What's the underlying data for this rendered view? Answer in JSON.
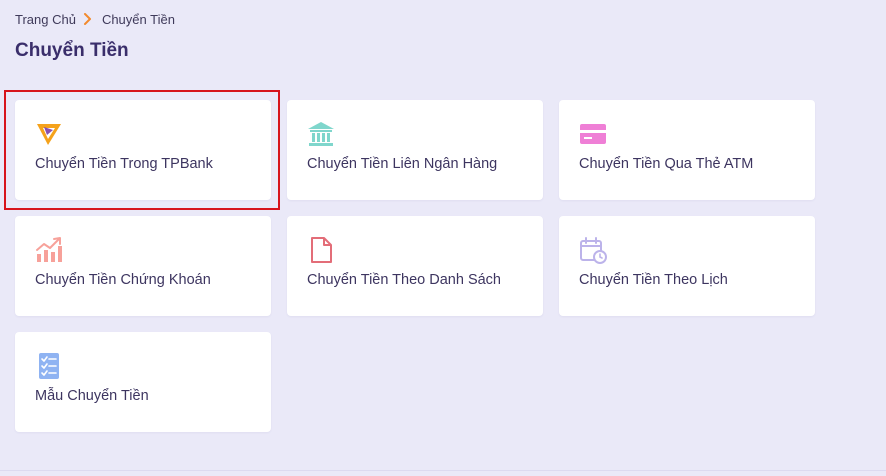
{
  "breadcrumb": {
    "home": "Trang Chủ",
    "current": "Chuyển Tiền"
  },
  "page": {
    "title": "Chuyển Tiền"
  },
  "cards": [
    {
      "label": "Chuyển Tiền Trong TPBank",
      "icon": "tpbank-logo-icon",
      "selected": true
    },
    {
      "label": "Chuyển Tiền Liên Ngân Hàng",
      "icon": "bank-icon"
    },
    {
      "label": "Chuyển Tiền Qua Thẻ ATM",
      "icon": "credit-card-icon"
    },
    {
      "label": "Chuyển Tiền Chứng Khoán",
      "icon": "stock-chart-icon"
    },
    {
      "label": "Chuyển Tiền Theo Danh Sách",
      "icon": "document-icon"
    },
    {
      "label": "Chuyển Tiền Theo Lịch",
      "icon": "calendar-clock-icon"
    },
    {
      "label": "Mẫu Chuyển Tiền",
      "icon": "checklist-icon"
    }
  ],
  "colors": {
    "background": "#eae9f8",
    "card": "#ffffff",
    "title": "#3a2e6b",
    "breadcrumb_separator": "#f28a2e",
    "highlight": "#d7141c",
    "tpbank_orange": "#f5a21b",
    "bank_teal": "#7fd6cc",
    "atm_pink": "#ef7fd6",
    "stock_salmon": "#f7a19a",
    "document_red": "#e36d78",
    "calendar_lavender": "#bcb3ea",
    "checklist_blue": "#8fb3f2"
  }
}
